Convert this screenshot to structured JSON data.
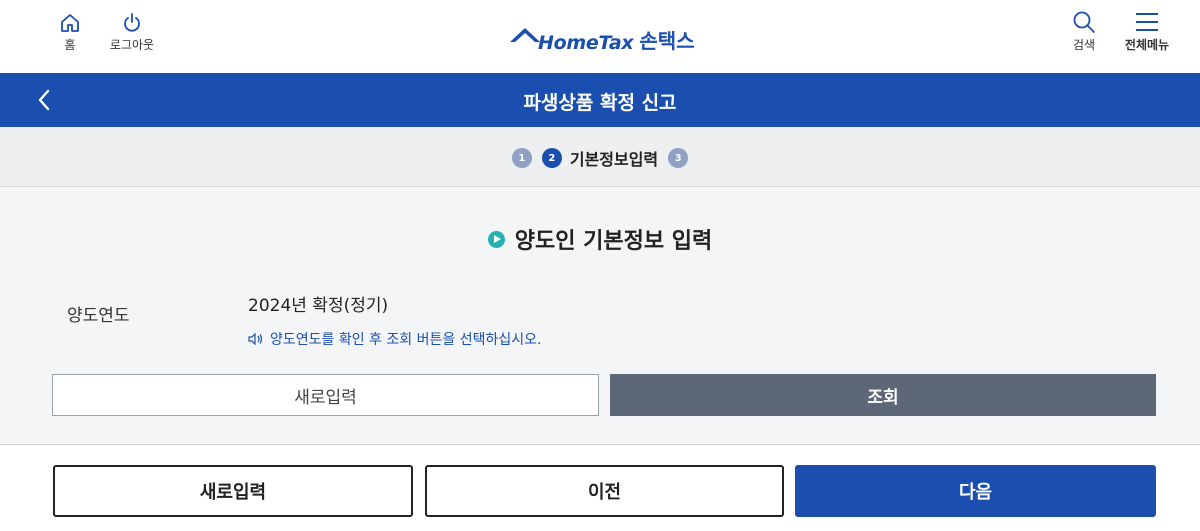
{
  "header": {
    "home_label": "홈",
    "logout_label": "로그아웃",
    "logo_text": "HomeTax",
    "logo_kr": "손택스",
    "search_label": "검색",
    "menu_label": "전체메뉴"
  },
  "title_bar": {
    "title": "파생상품 확정 신고"
  },
  "steps": {
    "items": [
      {
        "number": "1",
        "label": ""
      },
      {
        "number": "2",
        "label": "기본정보입력"
      },
      {
        "number": "3",
        "label": ""
      }
    ],
    "current": 2
  },
  "section": {
    "title": "양도인 기본정보 입력",
    "field_label": "양도연도",
    "field_value": "2024년 확정(정기)",
    "hint": "양도연도를 확인 후 조회 버튼을 선택하십시오.",
    "reset_label": "새로입력",
    "search_label": "조회"
  },
  "bottom": {
    "reset_label": "새로입력",
    "prev_label": "이전",
    "next_label": "다음"
  },
  "colors": {
    "primary": "#1a4fb0",
    "accent_teal": "#27b2b2",
    "gray_button": "#5d6778"
  }
}
